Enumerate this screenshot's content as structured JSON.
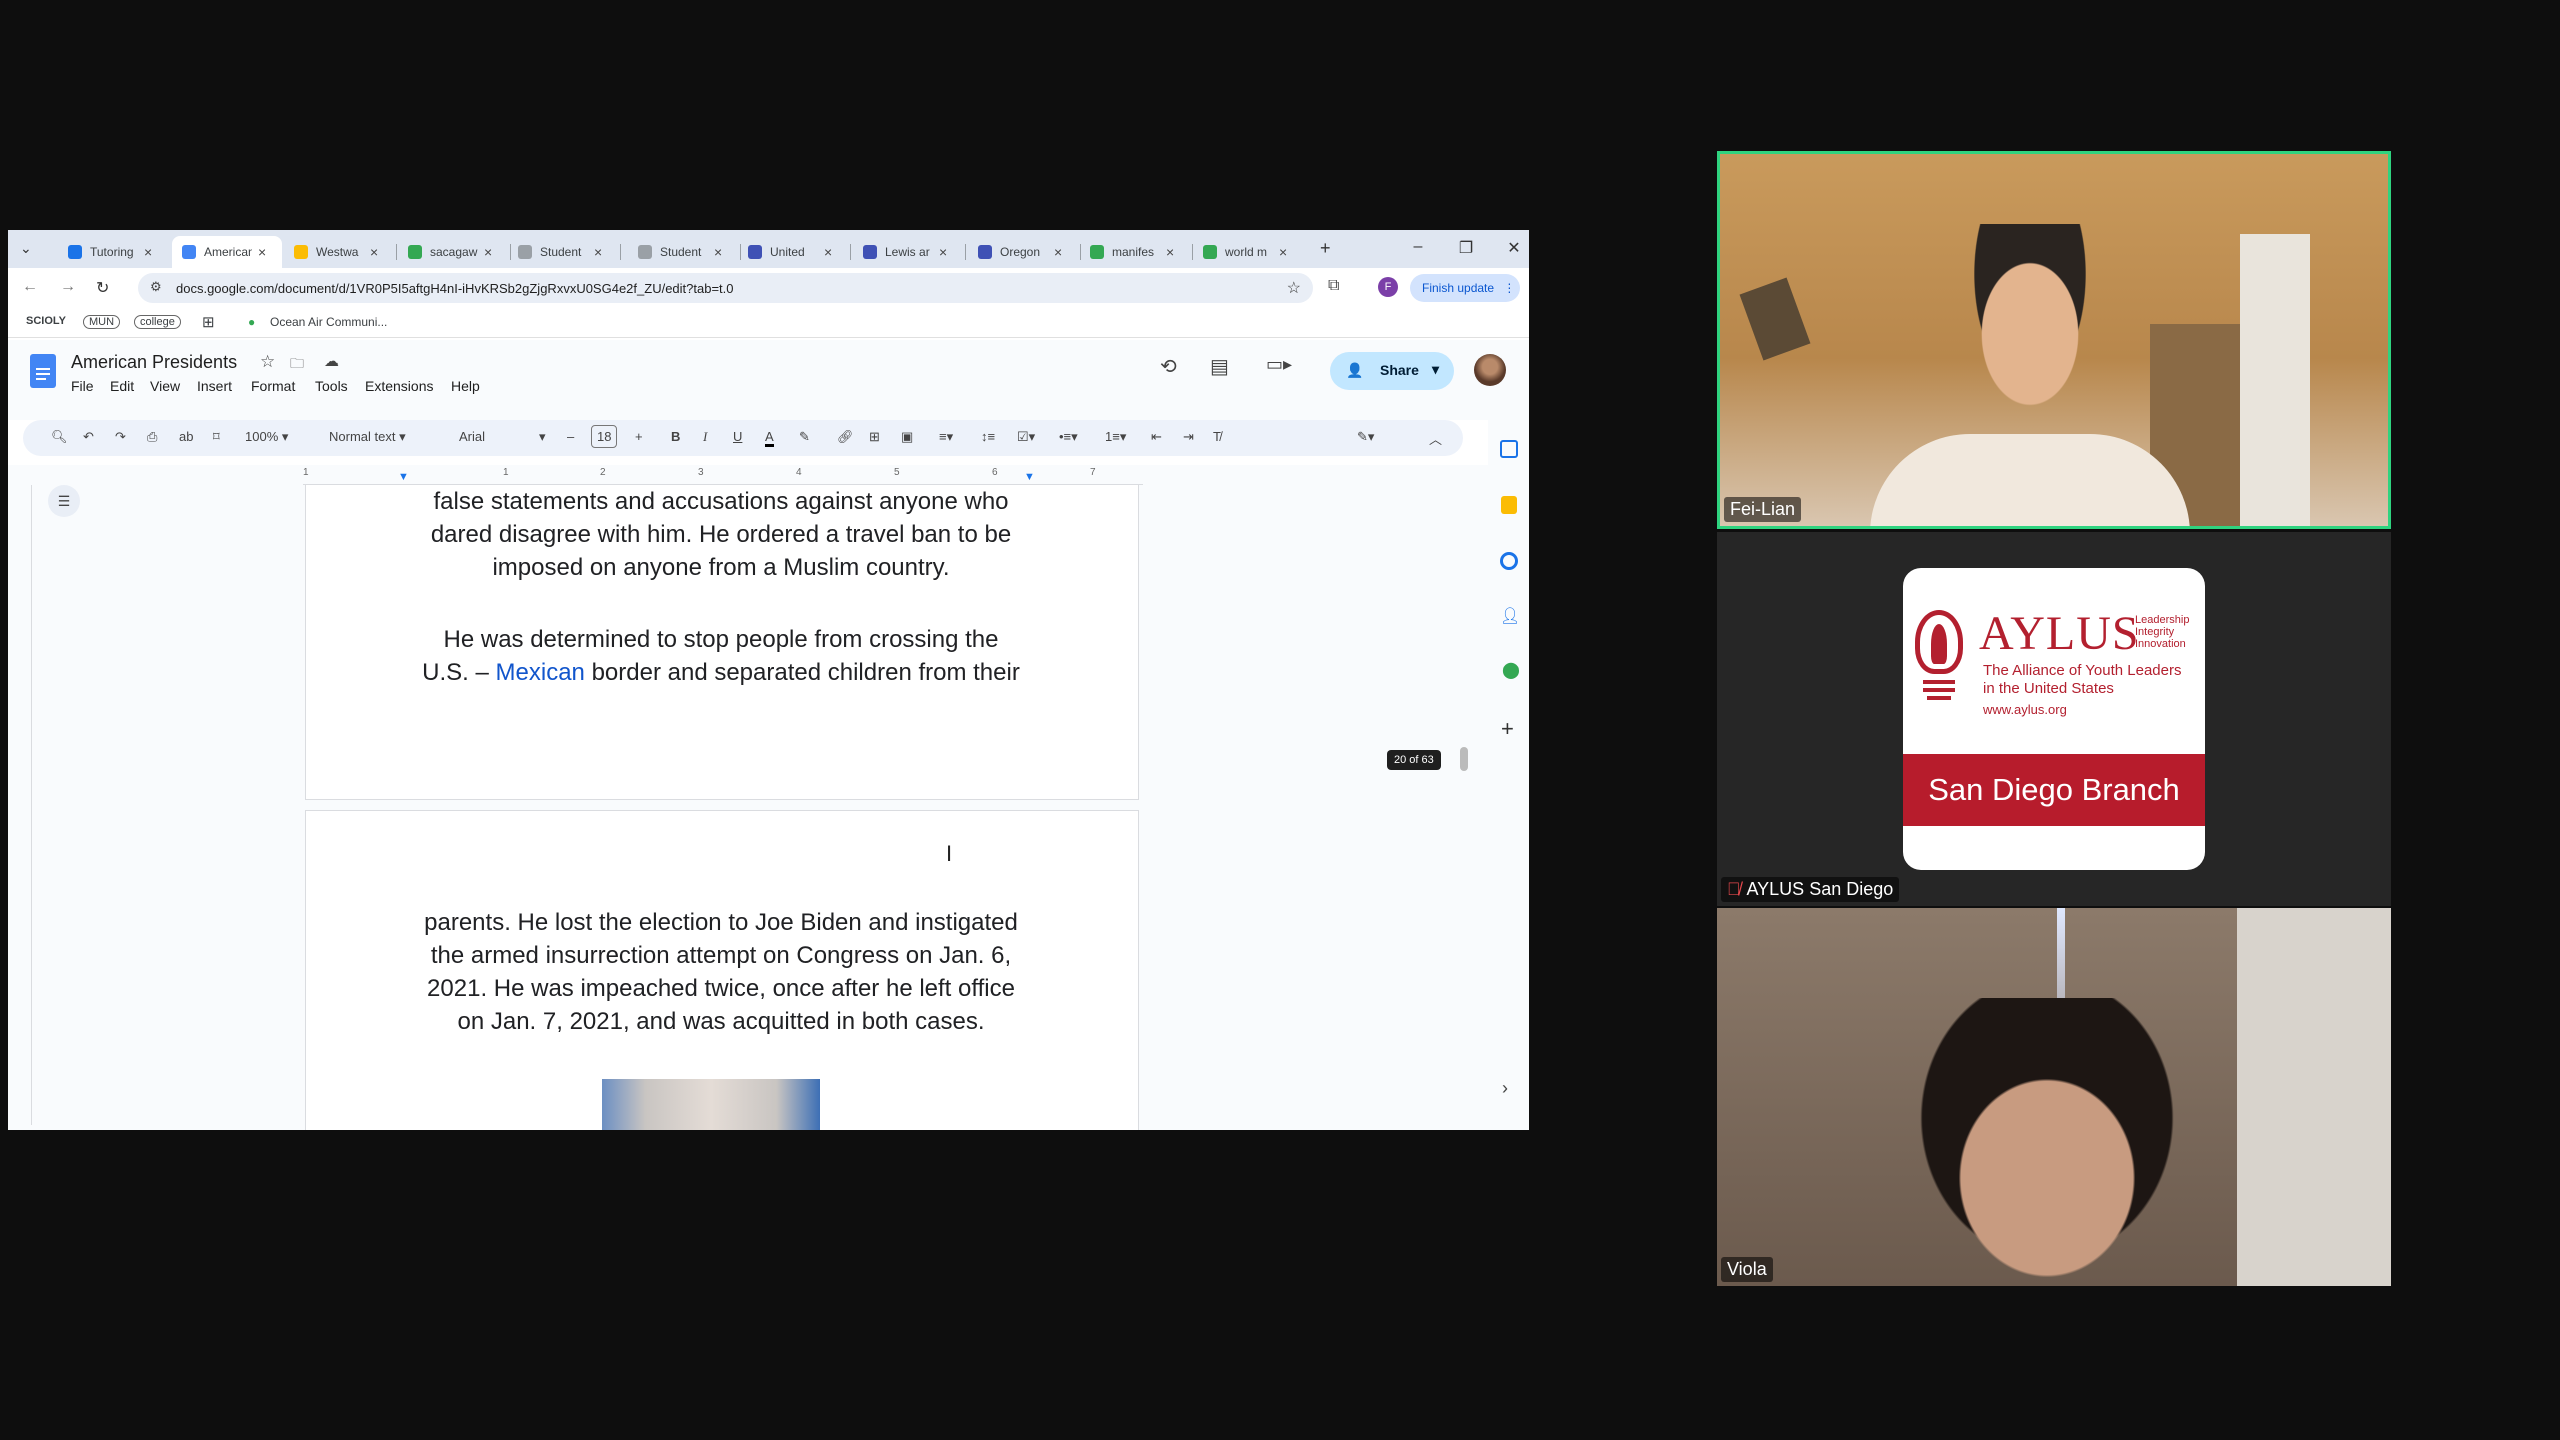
{
  "browser": {
    "tabs": [
      {
        "title": "Tutoring",
        "color": "#1a73e8"
      },
      {
        "title": "American",
        "color": "#4285f4"
      },
      {
        "title": "Westwa",
        "color": "#fbbc04"
      },
      {
        "title": "sacagaw",
        "color": "#34a853"
      },
      {
        "title": "Student",
        "color": "#9aa0a6"
      },
      {
        "title": "Student",
        "color": "#9aa0a6"
      },
      {
        "title": "United",
        "color": "#3f51b5"
      },
      {
        "title": "Lewis ar",
        "color": "#3f51b5"
      },
      {
        "title": "Oregon",
        "color": "#3f51b5"
      },
      {
        "title": "manifes",
        "color": "#34a853"
      },
      {
        "title": "world m",
        "color": "#34a853"
      }
    ],
    "url": "docs.google.com/document/d/1VR0P5I5aftgH4nI-iHvKRSb2gZjgRxvxU0SG4e2f_ZU/edit?tab=t.0",
    "finish_update": "Finish update",
    "profile_initial": "F",
    "bookmarks": [
      "SCIOLY",
      "MUN",
      "college",
      "Ocean Air Communi..."
    ]
  },
  "docs": {
    "title": "American Presidents",
    "menus": [
      "File",
      "Edit",
      "View",
      "Insert",
      "Format",
      "Tools",
      "Extensions",
      "Help"
    ],
    "share_label": "Share",
    "zoom": "100%",
    "style": "Normal text",
    "font": "Arial",
    "font_size": "18",
    "page_indicator": "20 of 63",
    "ruler_numbers": [
      "1",
      "1",
      "2",
      "3",
      "4",
      "5",
      "6",
      "7"
    ],
    "page1_p1": [
      "false statements and accusations against anyone who",
      "dared disagree with him. He ordered a travel ban to be",
      "imposed on anyone from a Muslim country."
    ],
    "page1_p2_line1": "He was determined to stop people from crossing the",
    "page1_p2_line2a": "U.S. – ",
    "page1_p2_link": "Mexican",
    "page1_p2_line2b": " border and separated children from their",
    "page2_p": [
      "parents. He lost the election to Joe Biden and instigated",
      "the armed insurrection attempt on Congress on Jan. 6,",
      "2021. He was impeached twice, once after he left office",
      "on Jan. 7, 2021, and was acquitted in both cases."
    ]
  },
  "participants": [
    {
      "name": "Fei-Lian",
      "active_speaker": true
    },
    {
      "name": "AYLUS San Diego",
      "muted": true,
      "logo": {
        "brand": "AYLUS",
        "tagline": [
          "Leadership",
          "Integrity",
          "Innovation"
        ],
        "full": [
          "The Alliance of Youth Leaders",
          "in the United States"
        ],
        "site": "www.aylus.org",
        "branch": "San Diego Branch"
      }
    },
    {
      "name": "Viola"
    }
  ]
}
